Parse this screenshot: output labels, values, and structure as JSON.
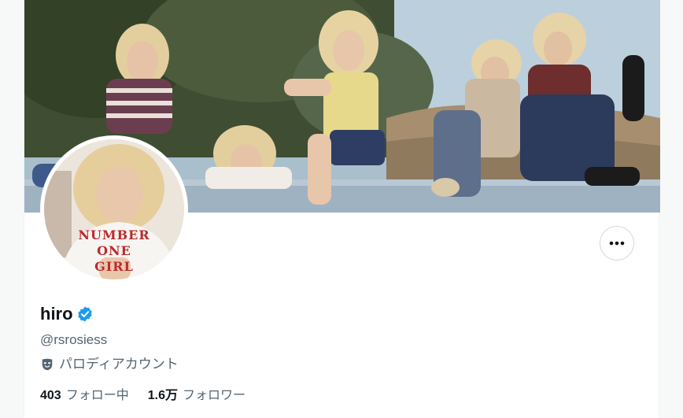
{
  "profile": {
    "display_name": "hiro",
    "handle": "@rsrosiess",
    "account_label": "パロディアカウント",
    "avatar_shirt_lines": [
      "NUMBER",
      "ONE",
      "GIRL"
    ]
  },
  "stats": {
    "following_count": "403",
    "following_label": "フォロー中",
    "followers_count": "1.6万",
    "followers_label": "フォロワー"
  },
  "icons": {
    "verified": "verified-badge-icon",
    "account_label": "theater-mask-icon",
    "more": "more-horizontal-icon"
  },
  "colors": {
    "verified_blue": "#1d9bf0",
    "primary_text": "#0f1419",
    "secondary_text": "#536471",
    "border": "#cfd9de"
  }
}
